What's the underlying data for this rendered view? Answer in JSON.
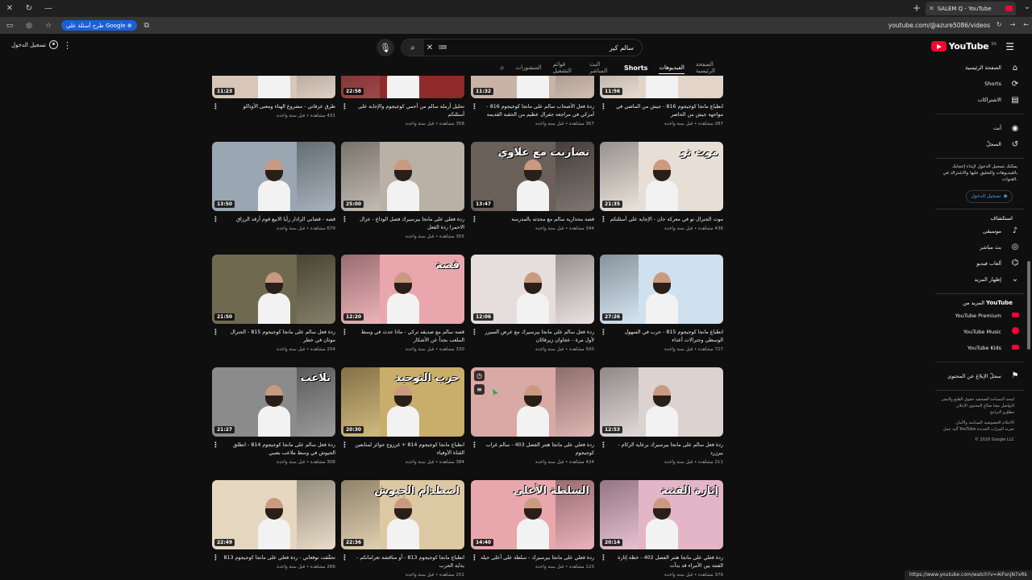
{
  "browser": {
    "tab_title": "SALEM Q - YouTube",
    "url": "youtube.com/@azure5086/videos",
    "ask_chip": "طرح أسئلة على Google",
    "status_url": "https://www.youtube.com/watch?v=AiFsnjN7xRk"
  },
  "header": {
    "sign_in": "تسجيل الدخول",
    "search_value": "سالم كير",
    "logo_text": "YouTube",
    "logo_region": "SA"
  },
  "channel_tabs": [
    {
      "label": "الصفحة الرئيسية",
      "state": "normal"
    },
    {
      "label": "الفيديوهات",
      "state": "active"
    },
    {
      "label": "Shorts",
      "state": "bold"
    },
    {
      "label": "البث المباشر",
      "state": "normal"
    },
    {
      "label": "قوائم التشغيل",
      "state": "normal"
    },
    {
      "label": "المنشورات",
      "state": "normal"
    }
  ],
  "sidebar": {
    "main": [
      {
        "label": "الصفحة الرئيسية",
        "icon": "home-icon",
        "glyph": "⌂"
      },
      {
        "label": "Shorts",
        "icon": "shorts-icon",
        "glyph": "⟳"
      },
      {
        "label": "الاشتراكات",
        "icon": "subscriptions-icon",
        "glyph": "▤"
      }
    ],
    "you": [
      {
        "label": "أنت",
        "icon": "you-icon",
        "glyph": "◉"
      },
      {
        "label": "السجلّ",
        "icon": "history-icon",
        "glyph": "↺"
      }
    ],
    "signin_note": "يمكنك تسجيل الدخول لإبداء إعجابك بالفيديوهات والتعليق عليها والاشتراك في القنوات.",
    "signin_button": "تسجيل الدخول",
    "explore_title": "استكشاف",
    "explore": [
      {
        "label": "موسيقى",
        "icon": "music-icon",
        "glyph": "♪"
      },
      {
        "label": "بث مباشر",
        "icon": "live-icon",
        "glyph": "◎"
      },
      {
        "label": "ألعاب فيديو",
        "icon": "gaming-icon",
        "glyph": "⌬"
      },
      {
        "label": "إظهار المزيد",
        "icon": "chevron-down-icon",
        "glyph": "⌄"
      }
    ],
    "more_title_prefix": "المزيد من",
    "more_title_brand": "YouTube",
    "more": [
      {
        "label": "YouTube Premium",
        "icon": "youtube-premium-icon"
      },
      {
        "label": "YouTube Music",
        "icon": "youtube-music-icon"
      },
      {
        "label": "YouTube Kids",
        "icon": "youtube-kids-icon"
      }
    ],
    "report": "سجلّ الإبلاغ عن المحتوى",
    "footer1": "لمحة  المساحة الصحفية  حقوق الطبع والنشر",
    "footer2": "التواصل معنا  صنّاع المحتوى  الإعلان",
    "footer3": "مطوّرو البرامج",
    "footer4": "الأحكام  الخصوصية  السياسة والأمان",
    "footer5": "آلية عمل YouTube  تجربة الميزات الجديدة",
    "copyright": "© 2026 Google LLC"
  },
  "videos": [
    {
      "title": "طرق عرفاني - مشروع الهناء ومعنى الأوتاكو",
      "stats": "431 مشاهدة • قبل سنة واحدة",
      "duration": "11:23",
      "bg": "#d8c7b9"
    },
    {
      "title": "تحليل أرملة سالم من أحمي كوجيجوم والإجابة على أسئلتكم",
      "stats": "358 مشاهدة • قبل سنة واحدة",
      "duration": "22:58",
      "bg": "#8e2a2a"
    },
    {
      "title": "ردة فعل الأصحاب سالم على مانجا كوجيجوم 816 - أمزكي في مراجعة جفرال عظيم من الحقبة القديمة",
      "stats": "367 مشاهدة • قبل سنة واحدة",
      "duration": "11:32",
      "bg": "#c9b3a6"
    },
    {
      "title": "انطباع مانجا كوجيجوم 816 - جيش من الماضي في مواجهة جيش من الحاضر",
      "stats": "287 مشاهدة • قبل سنة واحدة",
      "duration": "11:56",
      "bg": "#e2d4c8"
    },
    {
      "title": "قصة - قضاني الرادار رأيا الابيع قوم أرقد الرزاق",
      "stats": "679 مشاهدة • قبل سنة واحدة",
      "duration": "13:50",
      "bg": "#9aa6b2"
    },
    {
      "title": "ردة فعلي على مانجا بيرسيرك فصل الوداع - عزال الاحمرا ردة الفعل",
      "stats": "305 مشاهدة • قبل سنة واحدة",
      "duration": "25:00",
      "bg": "#b9b0a6"
    },
    {
      "title": "قصة محذارية سالم مع محدثه بالمدرسة",
      "stats": "344 مشاهدة • قبل سنة واحدة",
      "duration": "13:47",
      "bg": "#6a5f59",
      "overlay": "تضاربت مع علاوي"
    },
    {
      "title": "موت الجنرال تو في معركة حان - الإجابة على أسئلتكم",
      "stats": "438 مشاهدة • قبل سنة واحدة",
      "duration": "21:35",
      "bg": "#e7dfd6",
      "overlay": "موت تو"
    },
    {
      "title": "ردة فعل سالم على مانجا كوجيجوم 815 - الجنرال موتان في خطر",
      "stats": "254 مشاهدة • قبل سنة واحدة",
      "duration": "21:50",
      "bg": "#6f6a4f"
    },
    {
      "title": "قصة سالم مع صديقه تركي - ماذا حدث في وسط الملعب بجداً عن الأشكار",
      "stats": "330 مشاهدة • قبل سنة واحدة",
      "duration": "12:20",
      "bg": "#e9a7ad",
      "overlay": "قصة"
    },
    {
      "title": "ردة فعل سالم على مانجا بيرسيرك مع عرض السيرر لأول مرة - عجاوان زيرفائان",
      "stats": "500 مشاهدة • قبل سنة واحدة",
      "duration": "12:06",
      "bg": "#e6dedd"
    },
    {
      "title": "انطباع مانجا كوجيجوم 815 - حرب في السهول الوسطى وجنرالات أعداء",
      "stats": "727 مشاهدة • قبل سنة واحدة",
      "duration": "27:26",
      "bg": "#cfe1ef"
    },
    {
      "title": "ردة فعل سالم على مانجا كوجيجوم 814 - انطلق الجيوش في وسط ملاعب بضبي",
      "stats": "308 مشاهدة • قبل سنة واحدة",
      "duration": "21:27",
      "bg": "#8b8b8b",
      "overlay": "تلاعب"
    },
    {
      "title": "انطباع مانجا كوجيجوم 814 + غرزوج جوائز لمتابعين القناة الأوفياء",
      "stats": "384 مشاهدة • قبل سنة واحدة",
      "duration": "20:30",
      "bg": "#c9ad6b",
      "overlay": "حرب التوحيد"
    },
    {
      "title": "ردة فعلي على مانجا هنتر الفصل 403 - سالم غراب كوجيجوم",
      "stats": "424 مشاهدة • قبل سنة واحدة",
      "duration": "",
      "bg": "#d9a9a6",
      "hover": true
    },
    {
      "title": "ردة فعل سالم على مانجا بيرسيرك برعاية الزكام - بيرزرد",
      "stats": "211 مشاهدة • قبل سنة واحدة",
      "duration": "12:53",
      "bg": "#dcd2d0"
    },
    {
      "title": "تحقّقت توقعاتي - ردة فعلي على مانجا كوجيجوم 813",
      "stats": "266 مشاهدة • قبل سنة واحدة",
      "duration": "22:49",
      "bg": "#e6d7c0"
    },
    {
      "title": "انطباع مانجا كوجيجوم 813 - أو مناقشة تعراماتكم - بداية الحرب",
      "stats": "251 مشاهدة • قبل سنة واحدة",
      "duration": "22:36",
      "bg": "#dcc8a3",
      "overlay": "اصطدام الجيوش"
    },
    {
      "title": "ردة فعلي على مانجا بيرسيرك - سلطة على أعلى حيلة",
      "stats": "123 مشاهدة • قبل سنة واحدة",
      "duration": "14:40",
      "bg": "#e8a6ad",
      "overlay": "السلطة الأعلى"
    },
    {
      "title": "ردة فعلي على مانجا هنتر الفصل 402 - خطة إثارة الفتنة بين الأمراء قد بدأت",
      "stats": "379 مشاهدة • قبل سنة واحدة",
      "duration": "20:14",
      "bg": "#e3b6c7",
      "overlay": "إثارة الفتنة"
    }
  ]
}
